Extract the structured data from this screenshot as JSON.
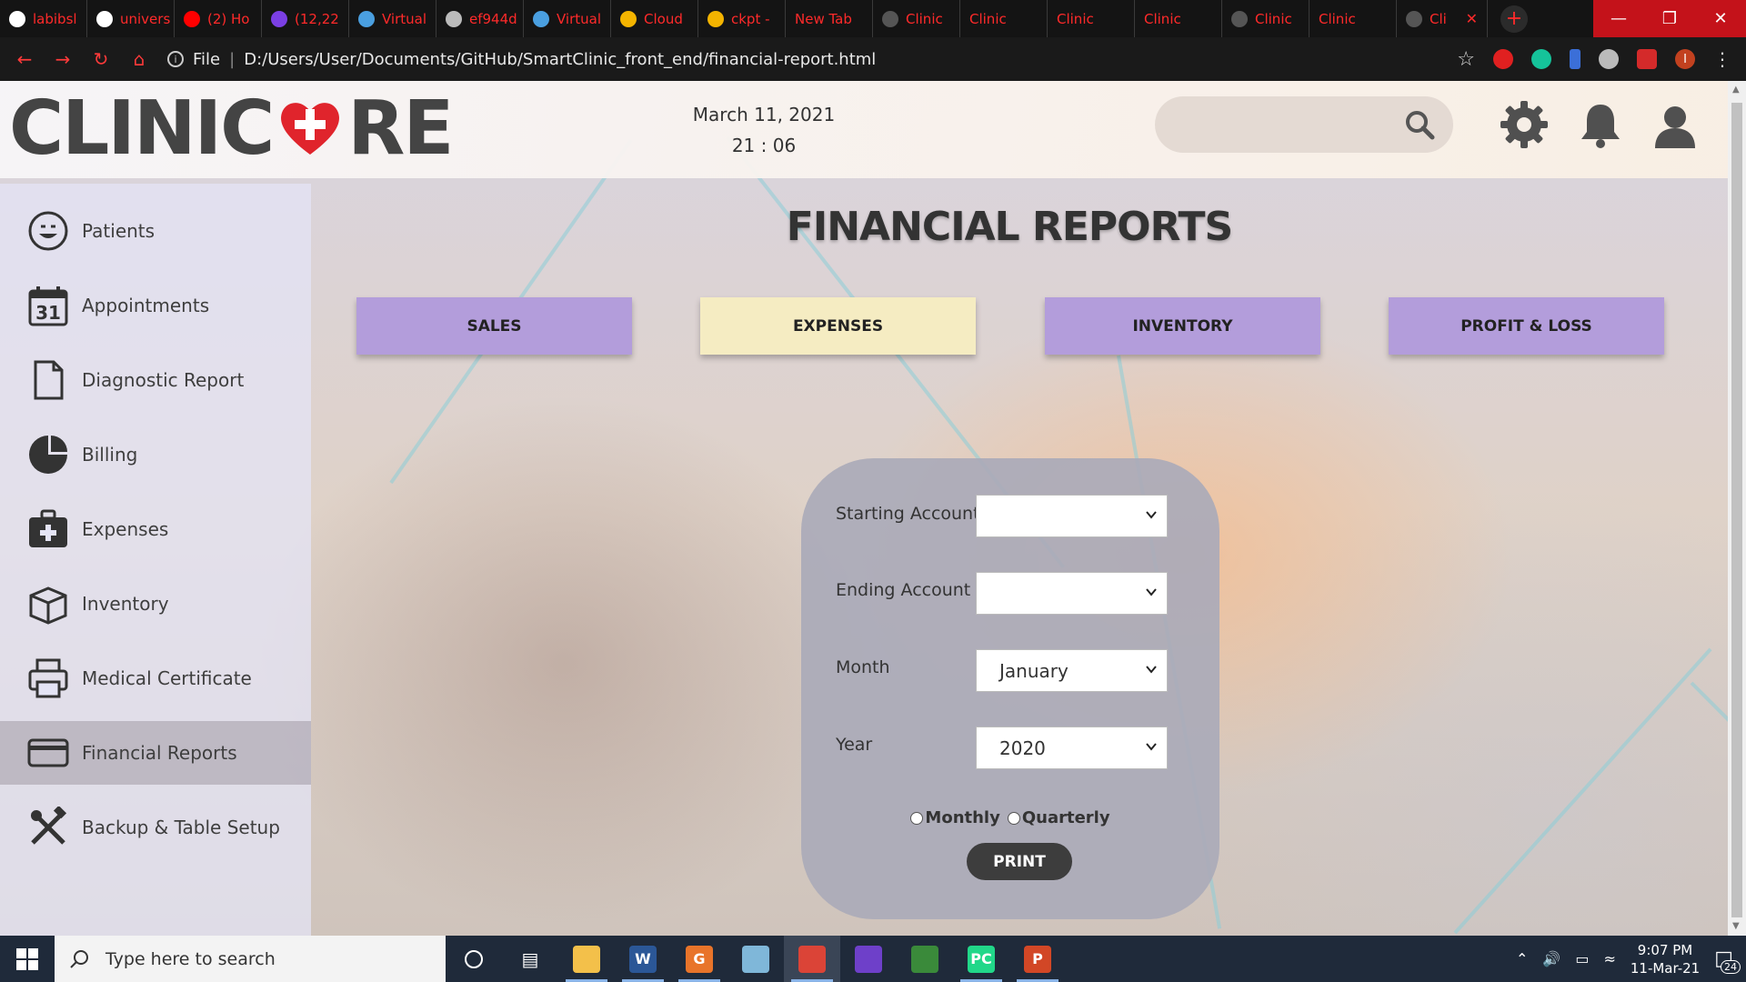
{
  "browser": {
    "tabs": [
      {
        "label": "labibsl",
        "icon": "github-icon",
        "color": "#ffffff"
      },
      {
        "label": "univers",
        "icon": "google-icon",
        "color": "#ffffff"
      },
      {
        "label": "(2) Ho",
        "icon": "youtube-icon",
        "color": "#ff0000"
      },
      {
        "label": "(12,22",
        "icon": "mail-icon",
        "color": "#7b3fe4"
      },
      {
        "label": "Virtual",
        "icon": "grid-icon",
        "color": "#4a9fe0"
      },
      {
        "label": "ef944d",
        "icon": "globe-icon",
        "color": "#bbbbbb"
      },
      {
        "label": "Virtual",
        "icon": "grid-icon",
        "color": "#4a9fe0"
      },
      {
        "label": "Cloud",
        "icon": "drive-icon",
        "color": "#f4b400"
      },
      {
        "label": "ckpt -",
        "icon": "drive-icon",
        "color": "#f4b400"
      },
      {
        "label": "New Tab",
        "icon": "",
        "color": ""
      },
      {
        "label": "Clinic",
        "icon": "clinic-icon",
        "color": "#555555"
      },
      {
        "label": "Clinic",
        "icon": "",
        "color": ""
      },
      {
        "label": "Clinic",
        "icon": "",
        "color": ""
      },
      {
        "label": "Clinic",
        "icon": "",
        "color": ""
      },
      {
        "label": "Clinic",
        "icon": "clinic-icon",
        "color": "#555555"
      },
      {
        "label": "Clinic",
        "icon": "",
        "color": ""
      },
      {
        "label": "Cli",
        "icon": "clinic-icon",
        "color": "#555555"
      }
    ],
    "new_tab": "+",
    "url_prefix": "File",
    "url": "D:/Users/User/Documents/GitHub/SmartClinic_front_end/financial-report.html",
    "accent": "#ff2a2a"
  },
  "header": {
    "logo_left": "CLINIC",
    "logo_right": "RE",
    "date": "March 11, 2021",
    "time": "21 : 06",
    "search_placeholder": ""
  },
  "sidebar": {
    "items": [
      {
        "label": "Patients",
        "icon": "smiley-icon"
      },
      {
        "label": "Appointments",
        "icon": "calendar-icon",
        "badge": "31"
      },
      {
        "label": "Diagnostic Report",
        "icon": "document-icon"
      },
      {
        "label": "Billing",
        "icon": "pie-chart-icon"
      },
      {
        "label": "Expenses",
        "icon": "medical-bag-icon"
      },
      {
        "label": "Inventory",
        "icon": "box-icon"
      },
      {
        "label": "Medical Certificate",
        "icon": "printer-icon"
      },
      {
        "label": "Financial Reports",
        "icon": "card-icon",
        "active": true
      },
      {
        "label": "Backup & Table Setup",
        "icon": "tools-icon"
      }
    ]
  },
  "main": {
    "title": "FINANCIAL REPORTS",
    "tabs": [
      {
        "label": "SALES",
        "color": "#b39ddb"
      },
      {
        "label": "EXPENSES",
        "color": "#f5ecc2"
      },
      {
        "label": "INVENTORY",
        "color": "#b39ddb"
      },
      {
        "label": "PROFIT & LOSS",
        "color": "#b39ddb"
      }
    ],
    "form": {
      "starting_account": {
        "label": "Starting Account",
        "value": ""
      },
      "ending_account": {
        "label": "Ending Account",
        "value": ""
      },
      "month": {
        "label": "Month",
        "value": "January"
      },
      "year": {
        "label": "Year",
        "value": "2020"
      },
      "radio_monthly": "Monthly",
      "radio_quarterly": "Quarterly",
      "print_label": "PRINT"
    }
  },
  "taskbar": {
    "search_placeholder": "Type here to search",
    "time": "9:07 PM",
    "date": "11-Mar-21",
    "notification_count": "24",
    "apps": [
      {
        "name": "file-explorer-icon",
        "color": "#f3c04a",
        "glyph": "",
        "open": true
      },
      {
        "name": "word-icon",
        "color": "#2b5797",
        "glyph": "W",
        "open": true
      },
      {
        "name": "pdf-reader-icon",
        "color": "#e8742a",
        "glyph": "G",
        "open": true
      },
      {
        "name": "notepad-icon",
        "color": "#7fb7d9",
        "glyph": "",
        "open": false
      },
      {
        "name": "chrome-icon",
        "color": "#db4437",
        "glyph": "",
        "open": true,
        "active": true
      },
      {
        "name": "github-desktop-icon",
        "color": "#6e40c9",
        "glyph": "",
        "open": false
      },
      {
        "name": "sheet-icon",
        "color": "#3a8a3a",
        "glyph": "",
        "open": false
      },
      {
        "name": "pycharm-icon",
        "color": "#21d789",
        "glyph": "PC",
        "open": true
      },
      {
        "name": "powerpoint-icon",
        "color": "#d24726",
        "glyph": "P",
        "open": true
      }
    ]
  }
}
